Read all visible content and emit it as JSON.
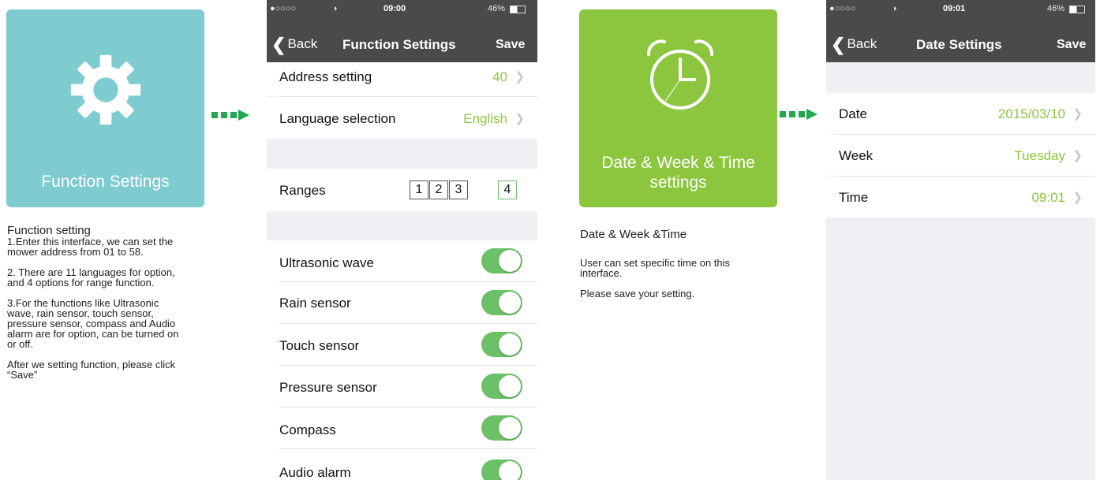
{
  "colors": {
    "teal": "#7ecbd0",
    "green": "#8cc63f",
    "navbar": "#4a4a4c",
    "arrow": "#1fa84f",
    "toggle_on": "#6cc067"
  },
  "tile1": {
    "title": "Function Settings",
    "icon": "gear-icon"
  },
  "desc1": {
    "heading": "Function setting",
    "p1": "1.Enter this interface, we can set the\nmower address from 01 to 58.",
    "p2": "2. There are 11 languages for option,\nand 4 options for range function.",
    "p3": "3.For the functions like Ultrasonic\nwave, rain sensor, touch sensor,\npressure sensor, compass and Audio\nalarm are for option, can be turned on\nor off.",
    "p4": "After we setting function, please click\n“Save”"
  },
  "phone1": {
    "status": {
      "signal": "●○○○○",
      "wifi": "᯼",
      "time": "09:00",
      "battery": "46%"
    },
    "nav": {
      "back": "Back",
      "title": "Function Settings",
      "save": "Save"
    },
    "address": {
      "label": "Address setting",
      "value": "40"
    },
    "language": {
      "label": "Language selection",
      "value": "English"
    },
    "ranges": {
      "label": "Ranges",
      "options": [
        "1",
        "2",
        "3",
        "4"
      ],
      "selected": "4"
    },
    "toggles": [
      {
        "label": "Ultrasonic wave",
        "on": true
      },
      {
        "label": "Rain sensor",
        "on": true
      },
      {
        "label": "Touch sensor",
        "on": true
      },
      {
        "label": "Pressure sensor",
        "on": true
      },
      {
        "label": "Compass",
        "on": true
      },
      {
        "label": "Audio alarm",
        "on": true
      }
    ]
  },
  "tile2": {
    "title": "Date & Week & Time\nsettings",
    "icon": "alarm-clock-icon"
  },
  "desc2": {
    "heading": "Date & Week &Time",
    "p1": "User can set specific time on this\ninterface.",
    "p2": "Please save your setting."
  },
  "phone2": {
    "status": {
      "signal": "●○○○○",
      "wifi": "᯼",
      "time": "09:01",
      "battery": "46%"
    },
    "nav": {
      "back": "Back",
      "title": "Date Settings",
      "save": "Save"
    },
    "rows": [
      {
        "label": "Date",
        "value": "2015/03/10"
      },
      {
        "label": "Week",
        "value": "Tuesday"
      },
      {
        "label": "Time",
        "value": "09:01"
      }
    ]
  }
}
